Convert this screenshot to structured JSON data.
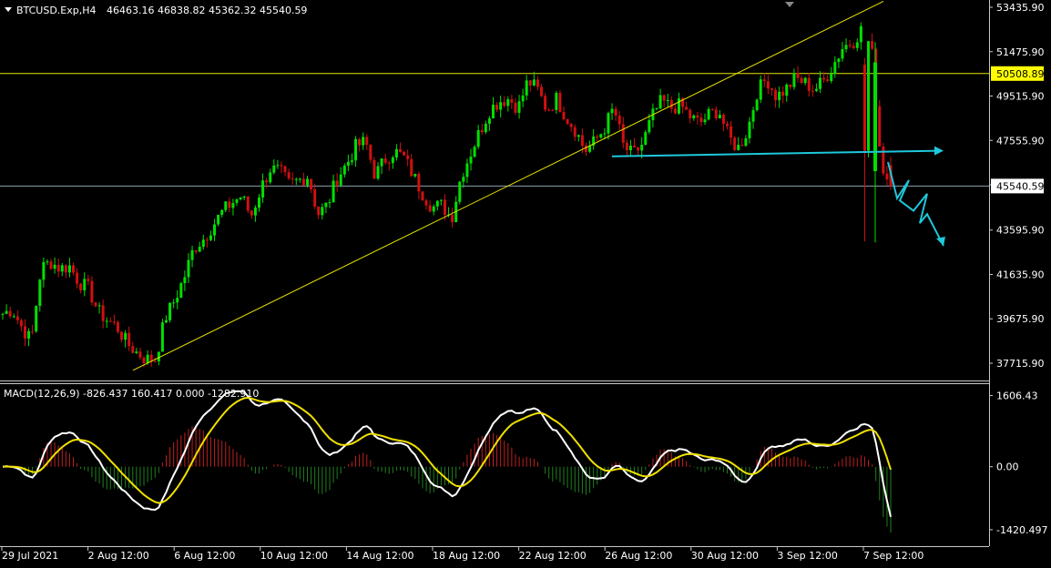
{
  "header": {
    "symbol": "BTCUSD.Exp,H4",
    "ohlc": "46463.16 46838.82 45362.32 45540.59",
    "macd_label": "MACD(12,26,9) -826.437 160.417 0.000 -1282.910"
  },
  "colors": {
    "background": "#000000",
    "bull": "#00e000",
    "bear": "#d01010",
    "trendline": "#e6e600",
    "hline": "#e6e600",
    "price_line": "#8aa0b0",
    "annotation": "#1ec8dc",
    "macd_line": "#ffffff",
    "signal_line": "#f0e000",
    "hist_up": "#c02020",
    "hist_down": "#208020",
    "frame": "#c8c8c8",
    "price_tag_yellow": "#ffff00",
    "price_tag_white": "#ffffff"
  },
  "price_tags": {
    "level": "50508.89",
    "current": "45540.59"
  },
  "chart_data": [
    {
      "type": "candlestick",
      "title": "BTCUSD.Exp,H4",
      "y_ticks": [
        "53435.90",
        "51475.90",
        "49515.90",
        "47555.90",
        "45595.90",
        "43595.90",
        "41635.90",
        "39675.90",
        "37715.90"
      ],
      "ylim": [
        36800,
        53700
      ],
      "x_ticks": [
        "29 Jul 2021",
        "2 Aug 12:00",
        "6 Aug 12:00",
        "10 Aug 12:00",
        "14 Aug 12:00",
        "18 Aug 12:00",
        "22 Aug 12:00",
        "26 Aug 12:00",
        "30 Aug 12:00",
        "3 Sep 12:00",
        "7 Sep 12:00"
      ],
      "last_ohlc": [
        46463.16,
        46838.82,
        45362.32,
        45540.59
      ],
      "horizontal_levels": [
        50508.89,
        45540.59
      ],
      "close_series": [
        39900,
        40100,
        39300,
        38700,
        41900,
        42200,
        41900,
        42000,
        41300,
        41000,
        40000,
        39600,
        39300,
        38600,
        38200,
        37900,
        37900,
        39700,
        40500,
        41500,
        42800,
        43200,
        43800,
        44400,
        44800,
        45100,
        44200,
        45400,
        46300,
        46200,
        45600,
        45800,
        46000,
        44300,
        44700,
        45900,
        46500,
        47300,
        47500,
        46000,
        46700,
        47100,
        46800,
        46000,
        45200,
        44600,
        44700,
        44100,
        46000,
        47000,
        48000,
        48900,
        49300,
        49400,
        49000,
        50200,
        49800,
        48900,
        49400,
        48600,
        48000,
        47100,
        47500,
        48100,
        49000,
        47300,
        46900,
        47400,
        48600,
        49300,
        49000,
        49100,
        48600,
        48300,
        48700,
        48900,
        47700,
        47200,
        48000,
        49700,
        50300,
        49500,
        49800,
        50300,
        50100,
        49800,
        50200,
        50900,
        51700,
        51900,
        52500,
        51600,
        46500,
        45540.59
      ]
    },
    {
      "type": "line",
      "title": "MACD(12,26,9)",
      "y_ticks": [
        "1606.43",
        "0.00",
        "-1420.497"
      ],
      "ylim": [
        -1750,
        1800
      ],
      "series": [
        {
          "name": "MACD",
          "values": [
            -826.437
          ]
        },
        {
          "name": "Signal",
          "values": [
            160.417
          ]
        }
      ],
      "last_values": {
        "macd": -826.437,
        "signal": 160.417,
        "level": 0.0,
        "histogram_min": -1282.91
      }
    }
  ]
}
